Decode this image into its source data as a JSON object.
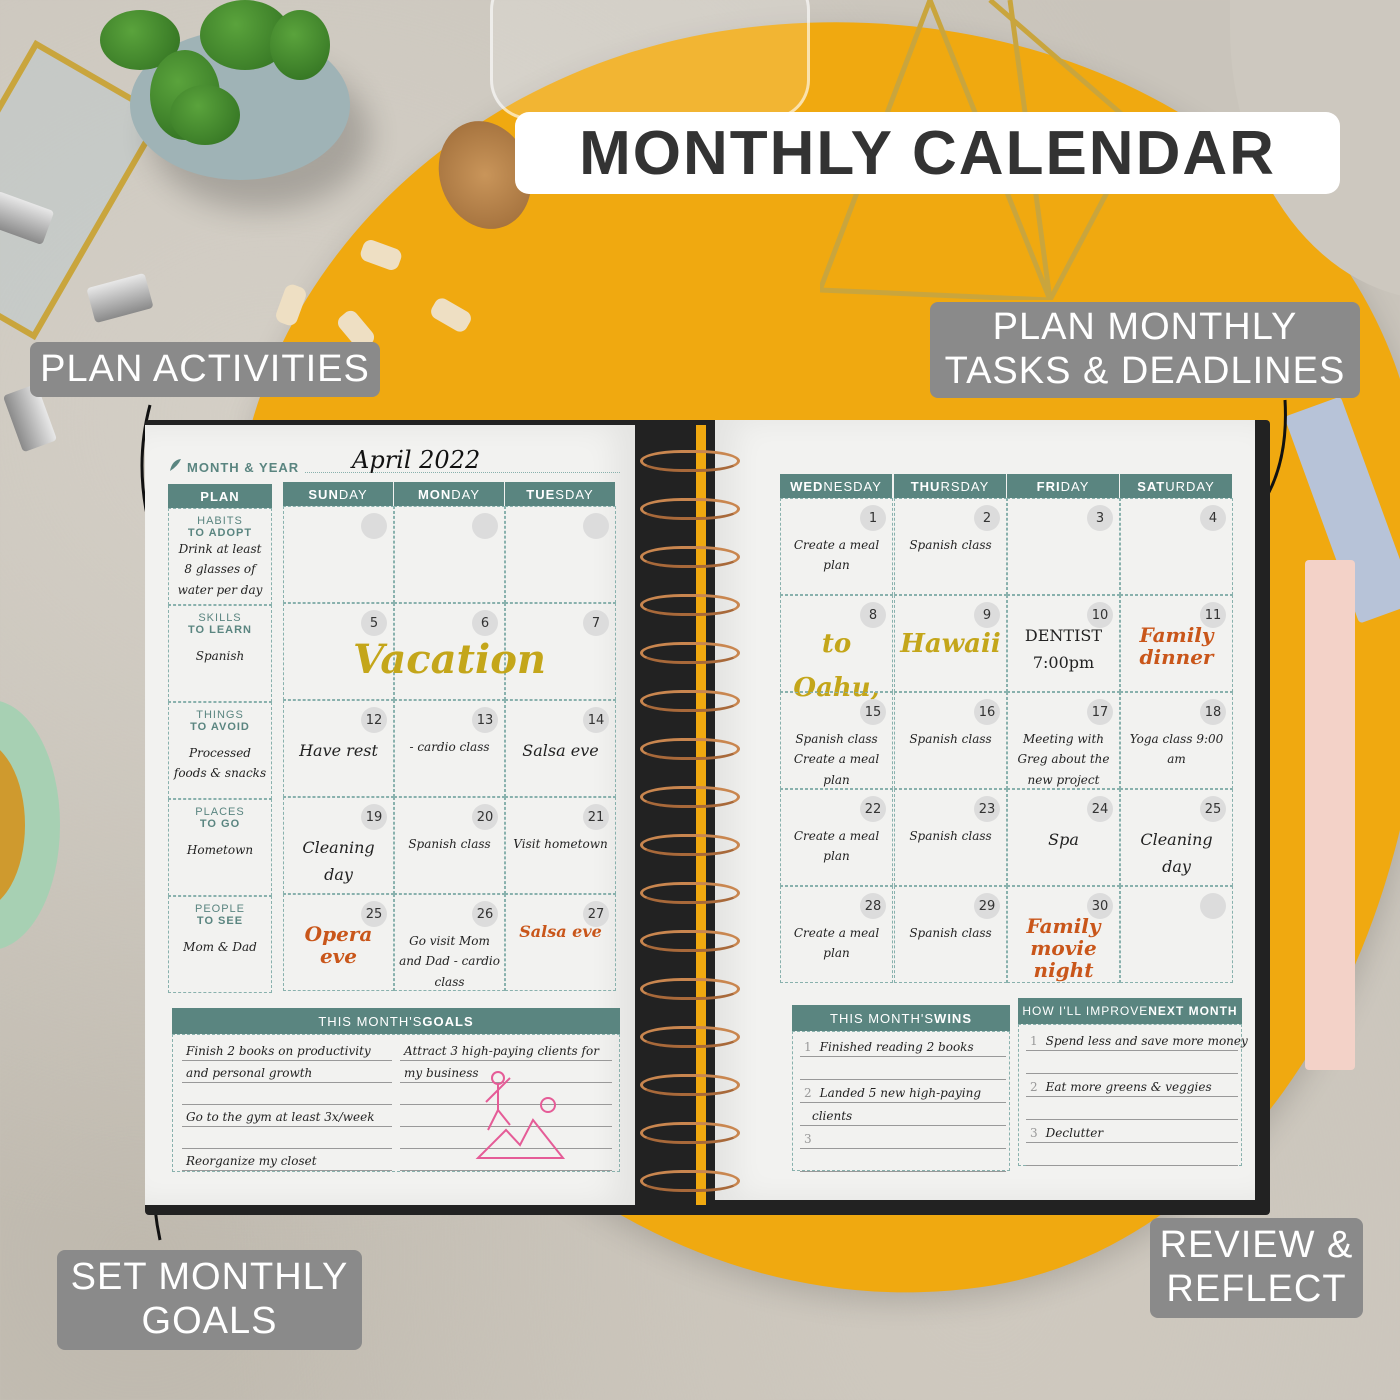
{
  "title": "MONTHLY CALENDAR",
  "callouts": {
    "plan_activities": "PLAN ACTIVITIES",
    "plan_monthly_l1": "PLAN MONTHLY",
    "plan_monthly_l2": "TASKS & DEADLINES",
    "set_goals_l1": "SET MONTHLY",
    "set_goals_l2": "GOALS",
    "review_l1": "REVIEW &",
    "review_l2": "REFLECT"
  },
  "colors": {
    "teal": "#5a8580",
    "yellow": "#f0a910",
    "orange_ink": "#c9561a",
    "gold_ink": "#c4a61a",
    "callout_gray": "#8a8a8a"
  },
  "planner": {
    "month_year_label": "MONTH & YEAR",
    "month_year_value": "April 2022",
    "plan_header": "PLAN",
    "days": [
      {
        "bold": "SUN",
        "rest": "DAY"
      },
      {
        "bold": "MON",
        "rest": "DAY"
      },
      {
        "bold": "TUE",
        "rest": "SDAY"
      },
      {
        "bold": "WED",
        "rest": "NESDAY"
      },
      {
        "bold": "THU",
        "rest": "RSDAY"
      },
      {
        "bold": "FRI",
        "rest": "DAY"
      },
      {
        "bold": "SAT",
        "rest": "URDAY"
      }
    ],
    "plan_sections": [
      {
        "cap1": "HABITS",
        "cap2": "TO ADOPT",
        "text": "Drink at least 8 glasses of water per day"
      },
      {
        "cap1": "SKILLS",
        "cap2": "TO LEARN",
        "text": "Spanish"
      },
      {
        "cap1": "THINGS",
        "cap2": "TO AVOID",
        "text": "Processed foods & snacks"
      },
      {
        "cap1": "PLACES",
        "cap2": "TO GO",
        "text": "Hometown"
      },
      {
        "cap1": "PEOPLE",
        "cap2": "TO SEE",
        "text": "Mom & Dad"
      }
    ],
    "left_cells": [
      {
        "num": "",
        "text": ""
      },
      {
        "num": "",
        "text": ""
      },
      {
        "num": "",
        "text": ""
      },
      {
        "num": "5",
        "text": ""
      },
      {
        "num": "6",
        "text": "Vacation"
      },
      {
        "num": "7",
        "text": ""
      },
      {
        "num": "12",
        "text": "Have rest"
      },
      {
        "num": "13",
        "text": "- cardio class"
      },
      {
        "num": "14",
        "text": "Salsa eve"
      },
      {
        "num": "19",
        "text": "Cleaning day"
      },
      {
        "num": "20",
        "text": "Spanish class"
      },
      {
        "num": "21",
        "text": "Visit hometown"
      },
      {
        "num": "25",
        "text": "Opera eve"
      },
      {
        "num": "26",
        "text": "Go visit Mom and Dad  - cardio class"
      },
      {
        "num": "27",
        "text": "Salsa eve"
      }
    ],
    "right_cells": [
      {
        "num": "1",
        "text": "Create a meal plan"
      },
      {
        "num": "2",
        "text": "Spanish class"
      },
      {
        "num": "3",
        "text": ""
      },
      {
        "num": "4",
        "text": ""
      },
      {
        "num": "8",
        "text": "to Oahu,"
      },
      {
        "num": "9",
        "text": "Hawaii"
      },
      {
        "num": "10",
        "text": "DENTIST 7:00pm"
      },
      {
        "num": "11",
        "text": "Family dinner"
      },
      {
        "num": "15",
        "text": "Spanish class Create a meal plan"
      },
      {
        "num": "16",
        "text": "Spanish class"
      },
      {
        "num": "17",
        "text": "Meeting with Greg about the new project"
      },
      {
        "num": "18",
        "text": "Yoga class 9:00 am"
      },
      {
        "num": "22",
        "text": "Create a meal plan"
      },
      {
        "num": "23",
        "text": "Spanish class"
      },
      {
        "num": "24",
        "text": "Spa"
      },
      {
        "num": "25",
        "text": "Cleaning day"
      },
      {
        "num": "28",
        "text": "Create a meal plan"
      },
      {
        "num": "29",
        "text": "Spanish class"
      },
      {
        "num": "30",
        "text": "Family movie night"
      },
      {
        "num": "",
        "text": ""
      }
    ],
    "goals": {
      "header_light": "THIS MONTH'S ",
      "header_bold": "GOALS",
      "left": [
        "Finish 2 books on productivity",
        "and personal growth",
        "",
        "Go to the gym at least 3x/week",
        "",
        "Reorganize my closet"
      ],
      "right": [
        "Attract 3 high-paying clients for",
        "my business",
        "",
        "",
        "",
        ""
      ]
    },
    "wins": {
      "header_light": "THIS MONTH'S ",
      "header_bold": "WINS",
      "items": [
        {
          "n": "1",
          "text": "Finished reading 2 books"
        },
        {
          "n": "",
          "text": ""
        },
        {
          "n": "2",
          "text": "Landed 5 new high-paying"
        },
        {
          "n": "",
          "text": "clients"
        },
        {
          "n": "3",
          "text": ""
        },
        {
          "n": "",
          "text": ""
        }
      ]
    },
    "improve": {
      "header_light": "HOW I'LL IMPROVE ",
      "header_bold": "NEXT MONTH",
      "items": [
        {
          "n": "1",
          "text": "Spend less and save more money"
        },
        {
          "n": "",
          "text": ""
        },
        {
          "n": "2",
          "text": "Eat more greens & veggies"
        },
        {
          "n": "",
          "text": ""
        },
        {
          "n": "3",
          "text": "Declutter"
        },
        {
          "n": "",
          "text": ""
        }
      ]
    }
  }
}
